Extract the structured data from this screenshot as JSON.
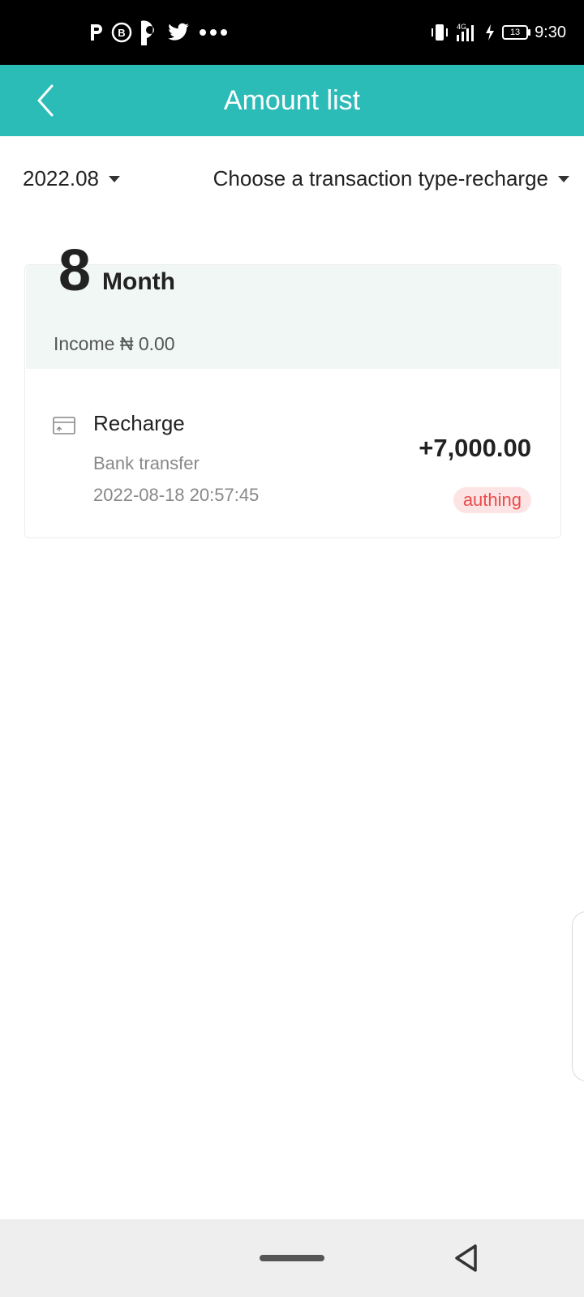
{
  "status_bar": {
    "time": "9:30",
    "battery": "13",
    "network": "4G",
    "notification_icons": [
      "p-app-icon",
      "b-app-icon",
      "p-bold-app-icon",
      "twitter-icon",
      "more-dots-icon"
    ],
    "system_icons": [
      "vibrate-icon",
      "signal-icon",
      "charging-icon",
      "battery-icon"
    ]
  },
  "app_bar": {
    "title": "Amount list",
    "back_icon": "chevron-left-icon"
  },
  "filters": {
    "month": "2022.08",
    "type": "Choose a transaction type-recharge"
  },
  "summary": {
    "month_number": "8",
    "month_label": "Month",
    "income": "Income ₦ 0.00"
  },
  "transactions": [
    {
      "icon": "card-icon",
      "title": "Recharge",
      "method": "Bank transfer",
      "date": "2022-08-18 20:57:45",
      "amount": "+7,000.00",
      "status": "authing"
    }
  ],
  "colors": {
    "primary": "#2cbcb8",
    "summary_bg": "#f0f7f5",
    "status_text": "#ea4c4c",
    "status_bg": "#fde4e4"
  },
  "nav_bar": {
    "icons": [
      "home-pill-icon",
      "back-triangle-icon"
    ]
  }
}
